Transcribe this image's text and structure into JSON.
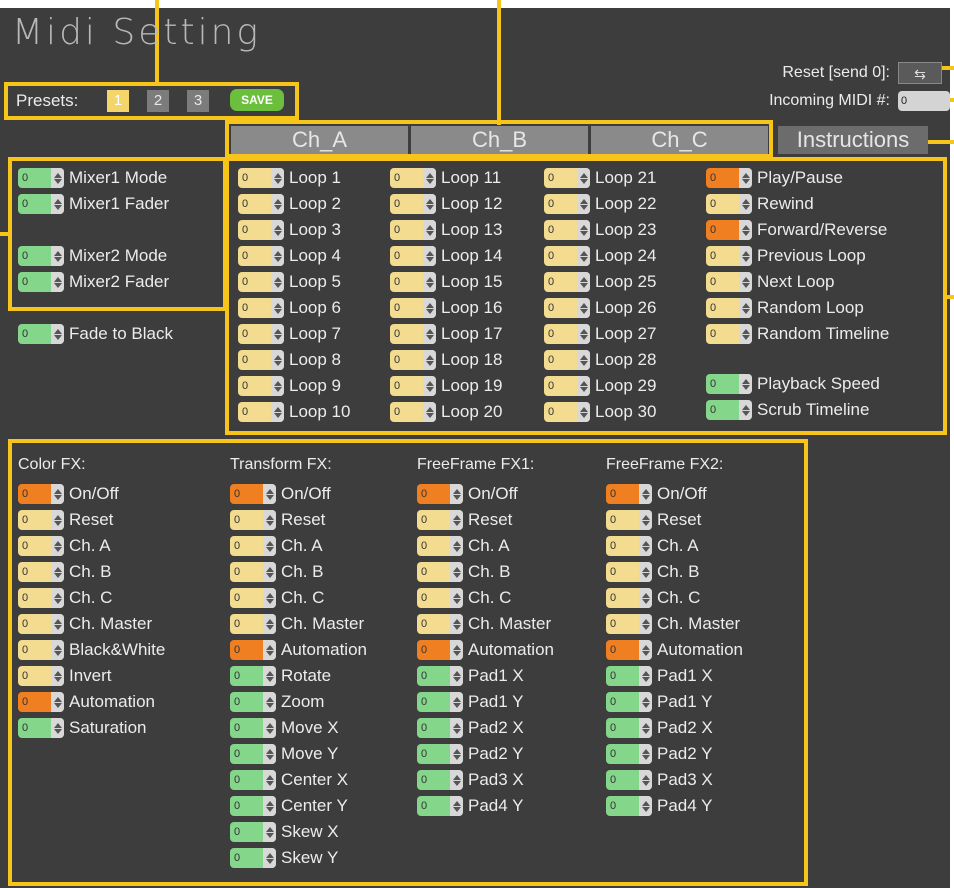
{
  "title": "Midi Setting",
  "presets": {
    "label": "Presets:",
    "buttons": [
      "1",
      "2",
      "3"
    ],
    "selected": "1",
    "save_label": "SAVE"
  },
  "reset": {
    "label": "Reset [send 0]:"
  },
  "incoming": {
    "label": "Incoming MIDI #:",
    "value": "0"
  },
  "tabs": [
    "Ch_A",
    "Ch_B",
    "Ch_C",
    "Instructions"
  ],
  "mixer": [
    {
      "label": "Mixer1 Mode",
      "value": "0",
      "color": "green"
    },
    {
      "label": "Mixer1 Fader",
      "value": "0",
      "color": "green"
    },
    {
      "label": "Mixer2 Mode",
      "value": "0",
      "color": "green"
    },
    {
      "label": "Mixer2 Fader",
      "value": "0",
      "color": "green"
    }
  ],
  "fade": {
    "label": "Fade to Black",
    "value": "0",
    "color": "green"
  },
  "loops": [
    [
      "Loop 1",
      "Loop 2",
      "Loop 3",
      "Loop 4",
      "Loop 5",
      "Loop 6",
      "Loop 7",
      "Loop 8",
      "Loop 9",
      "Loop 10"
    ],
    [
      "Loop 11",
      "Loop 12",
      "Loop 13",
      "Loop 14",
      "Loop 15",
      "Loop 16",
      "Loop 17",
      "Loop 18",
      "Loop 19",
      "Loop 20"
    ],
    [
      "Loop 21",
      "Loop 22",
      "Loop 23",
      "Loop 24",
      "Loop 25",
      "Loop 26",
      "Loop 27",
      "Loop 28",
      "Loop 29",
      "Loop 30"
    ]
  ],
  "playback": [
    {
      "label": "Play/Pause",
      "value": "0",
      "color": "orange"
    },
    {
      "label": "Rewind",
      "value": "0",
      "color": "yellow"
    },
    {
      "label": "Forward/Reverse",
      "value": "0",
      "color": "orange"
    },
    {
      "label": "Previous Loop",
      "value": "0",
      "color": "yellow"
    },
    {
      "label": "Next Loop",
      "value": "0",
      "color": "yellow"
    },
    {
      "label": "Random Loop",
      "value": "0",
      "color": "yellow"
    },
    {
      "label": "Random Timeline",
      "value": "0",
      "color": "yellow"
    },
    {
      "label": "Playback Speed",
      "value": "0",
      "color": "green"
    },
    {
      "label": "Scrub Timeline",
      "value": "0",
      "color": "green"
    }
  ],
  "fx_groups": [
    {
      "title": "Color FX:",
      "items": [
        {
          "label": "On/Off",
          "color": "orange"
        },
        {
          "label": "Reset",
          "color": "yellow"
        },
        {
          "label": "Ch. A",
          "color": "yellow"
        },
        {
          "label": "Ch. B",
          "color": "yellow"
        },
        {
          "label": "Ch. C",
          "color": "yellow"
        },
        {
          "label": "Ch. Master",
          "color": "yellow"
        },
        {
          "label": "Black&White",
          "color": "yellow"
        },
        {
          "label": "Invert",
          "color": "yellow"
        },
        {
          "label": "Automation",
          "color": "orange"
        },
        {
          "label": "Saturation",
          "color": "green"
        }
      ]
    },
    {
      "title": "Transform FX:",
      "items": [
        {
          "label": "On/Off",
          "color": "orange"
        },
        {
          "label": "Reset",
          "color": "yellow"
        },
        {
          "label": "Ch. A",
          "color": "yellow"
        },
        {
          "label": "Ch. B",
          "color": "yellow"
        },
        {
          "label": "Ch. C",
          "color": "yellow"
        },
        {
          "label": "Ch. Master",
          "color": "yellow"
        },
        {
          "label": "Automation",
          "color": "orange"
        },
        {
          "label": "Rotate",
          "color": "green"
        },
        {
          "label": "Zoom",
          "color": "green"
        },
        {
          "label": "Move X",
          "color": "green"
        },
        {
          "label": "Move Y",
          "color": "green"
        },
        {
          "label": "Center X",
          "color": "green"
        },
        {
          "label": "Center Y",
          "color": "green"
        },
        {
          "label": "Skew X",
          "color": "green"
        },
        {
          "label": "Skew Y",
          "color": "green"
        }
      ]
    },
    {
      "title": "FreeFrame FX1:",
      "items": [
        {
          "label": "On/Off",
          "color": "orange"
        },
        {
          "label": "Reset",
          "color": "yellow"
        },
        {
          "label": "Ch. A",
          "color": "yellow"
        },
        {
          "label": "Ch. B",
          "color": "yellow"
        },
        {
          "label": "Ch. C",
          "color": "yellow"
        },
        {
          "label": "Ch. Master",
          "color": "yellow"
        },
        {
          "label": "Automation",
          "color": "orange"
        },
        {
          "label": "Pad1 X",
          "color": "green"
        },
        {
          "label": "Pad1 Y",
          "color": "green"
        },
        {
          "label": "Pad2 X",
          "color": "green"
        },
        {
          "label": "Pad2 Y",
          "color": "green"
        },
        {
          "label": "Pad3 X",
          "color": "green"
        },
        {
          "label": "Pad4 Y",
          "color": "green"
        }
      ]
    },
    {
      "title": "FreeFrame FX2:",
      "items": [
        {
          "label": "On/Off",
          "color": "orange"
        },
        {
          "label": "Reset",
          "color": "yellow"
        },
        {
          "label": "Ch. A",
          "color": "yellow"
        },
        {
          "label": "Ch. B",
          "color": "yellow"
        },
        {
          "label": "Ch. C",
          "color": "yellow"
        },
        {
          "label": "Ch. Master",
          "color": "yellow"
        },
        {
          "label": "Automation",
          "color": "orange"
        },
        {
          "label": "Pad1 X",
          "color": "green"
        },
        {
          "label": "Pad1 Y",
          "color": "green"
        },
        {
          "label": "Pad2 X",
          "color": "green"
        },
        {
          "label": "Pad2 Y",
          "color": "green"
        },
        {
          "label": "Pad3 X",
          "color": "green"
        },
        {
          "label": "Pad4 Y",
          "color": "green"
        }
      ]
    }
  ],
  "default_value": "0",
  "colors": {
    "highlight": "#f7c419",
    "panel": "#3d3d3d",
    "yellow": "#f3dc8f",
    "orange": "#f07f22",
    "green": "#84d68a"
  }
}
